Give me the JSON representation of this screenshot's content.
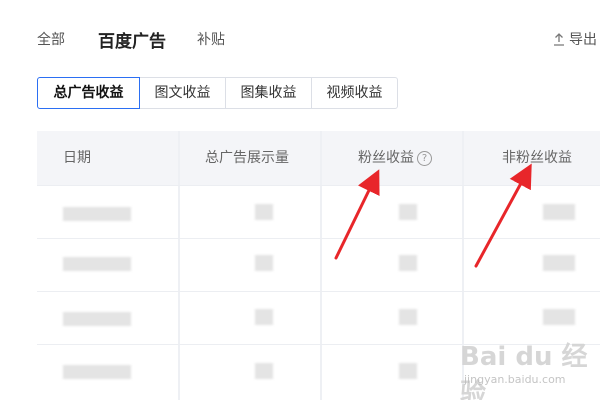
{
  "top_tabs": {
    "all": "全部",
    "baidu_ads": "百度广告",
    "subsidy": "补贴"
  },
  "export_label": "导出",
  "sub_tabs": [
    "总广告收益",
    "图文收益",
    "图集收益",
    "视频收益"
  ],
  "table": {
    "headers": {
      "date": "日期",
      "impressions": "总广告展示量",
      "fans_income": "粉丝收益",
      "nonfans_income": "非粉丝收益"
    }
  },
  "watermark": {
    "logo": "Bai du 经验",
    "url": "jingyan.baidu.com"
  },
  "colors": {
    "accent": "#2b6ff3",
    "arrow": "#e8262a",
    "header_bg": "#f4f5f8"
  }
}
